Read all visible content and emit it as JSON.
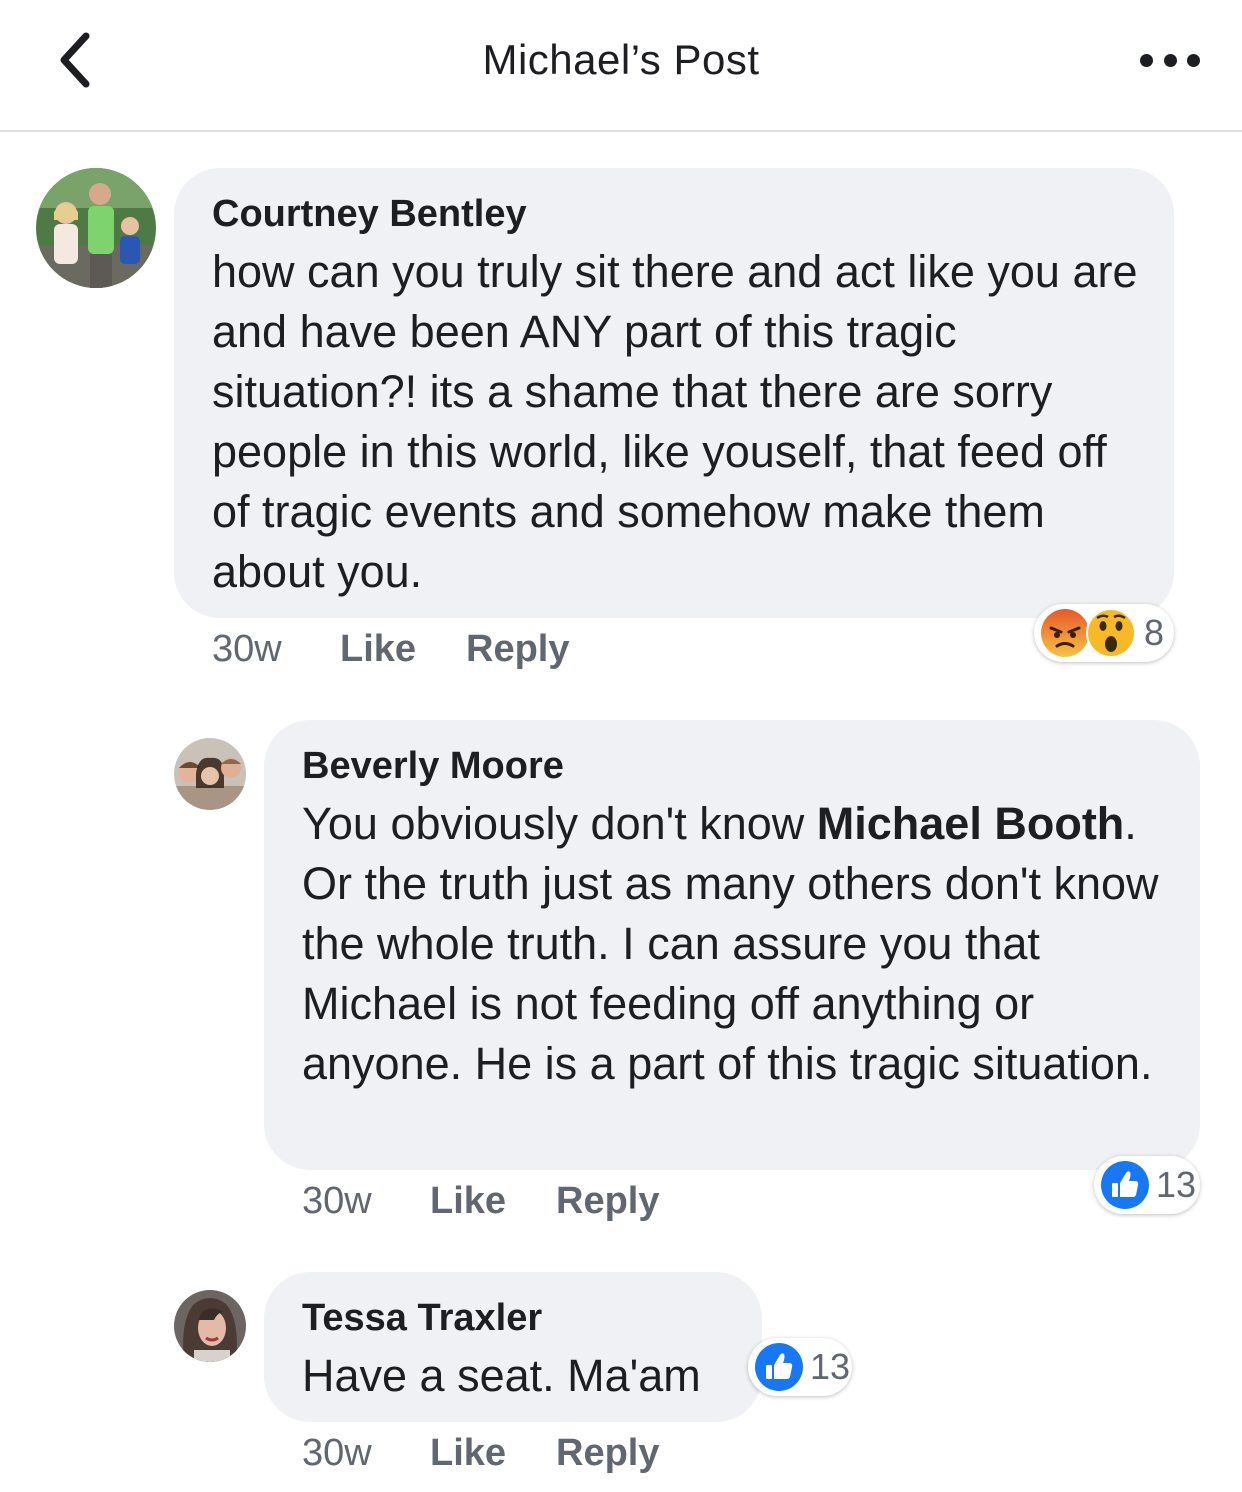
{
  "header": {
    "title": "Michael’s Post"
  },
  "comments": [
    {
      "author": "Courtney Bentley",
      "text": "how can you truly sit there and act like you are and have been ANY part of this tragic situation?! its a shame that there are sorry people in this world, like youself, that feed off of tragic events and somehow make them about you.",
      "time": "30w",
      "like_label": "Like",
      "reply_label": "Reply",
      "reaction_icons": [
        "angry-reaction-icon",
        "wow-reaction-icon"
      ],
      "reaction_count": "8"
    },
    {
      "author": "Beverly Moore",
      "text_before": "You obviously don't know ",
      "mention": "Michael Booth",
      "text_after": ".  Or the truth just as many others don't know the whole truth.  I can assure you that Michael is not feeding off anything or anyone.  He is a part of this tragic situation.",
      "time": "30w",
      "like_label": "Like",
      "reply_label": "Reply",
      "reaction_icons": [
        "like-reaction-icon"
      ],
      "reaction_count": "13"
    },
    {
      "author": "Tessa Traxler",
      "text": "Have a seat. Ma'am",
      "time": "30w",
      "like_label": "Like",
      "reply_label": "Reply",
      "reaction_icons": [
        "like-reaction-icon"
      ],
      "reaction_count": "13"
    }
  ],
  "colors": {
    "bubble": "#f0f1f4",
    "like_blue": "#1877f2",
    "angry_orange": "#e8582b",
    "wow_yellow": "#f7b928",
    "muted_text": "#606770"
  }
}
